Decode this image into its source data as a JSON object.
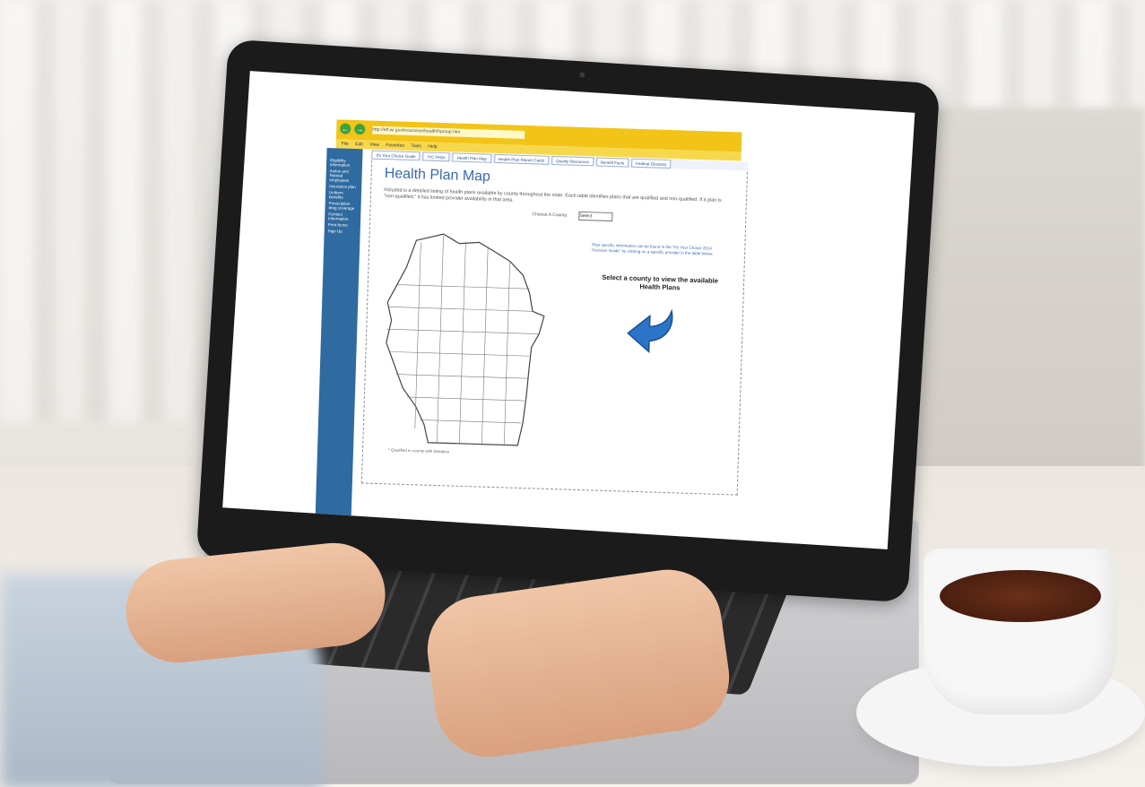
{
  "browser": {
    "url": "http://etf.wi.gov/insurance/health/hpmap.htm",
    "menu": [
      "File",
      "Edit",
      "View",
      "Favorites",
      "Tools",
      "Help"
    ]
  },
  "sidebar": {
    "items": [
      "Eligibility information",
      "Active and Retired employees",
      "Insurance plan",
      "Uniform benefits",
      "Prescription drug coverage",
      "Contact information",
      "Print forms",
      "Sign Up"
    ],
    "highlight_color": "#2f6aa0"
  },
  "tabs": [
    "It's Your Choice Guide",
    "IYC FAQs",
    "Health Plan Map",
    "Health Plan Report Cards",
    "Quality Resources",
    "Benefit Facts",
    "Federal Glossary"
  ],
  "page": {
    "title": "Health Plan Map",
    "intro": "Included is a detailed listing of health plans available by county throughout the state. Each table identifies plans that are qualified and non-qualified. If a plan is \"non-qualified,\" it has limited provider availability in that area.",
    "county_label": "Choose A County:",
    "county_selected": "Select",
    "side_note": "Plan specific information can be found in the \"It's Your Choice 2014 Decision Guide\" by clicking on a specific provider in the table below.",
    "cta": "Select a county to view the available Health Plans",
    "footnote": "* Qualified in county with limitation"
  },
  "colors": {
    "accent_blue": "#3a6ab0",
    "address_bar": "#f2c417",
    "arrow": "#2a74c9"
  }
}
